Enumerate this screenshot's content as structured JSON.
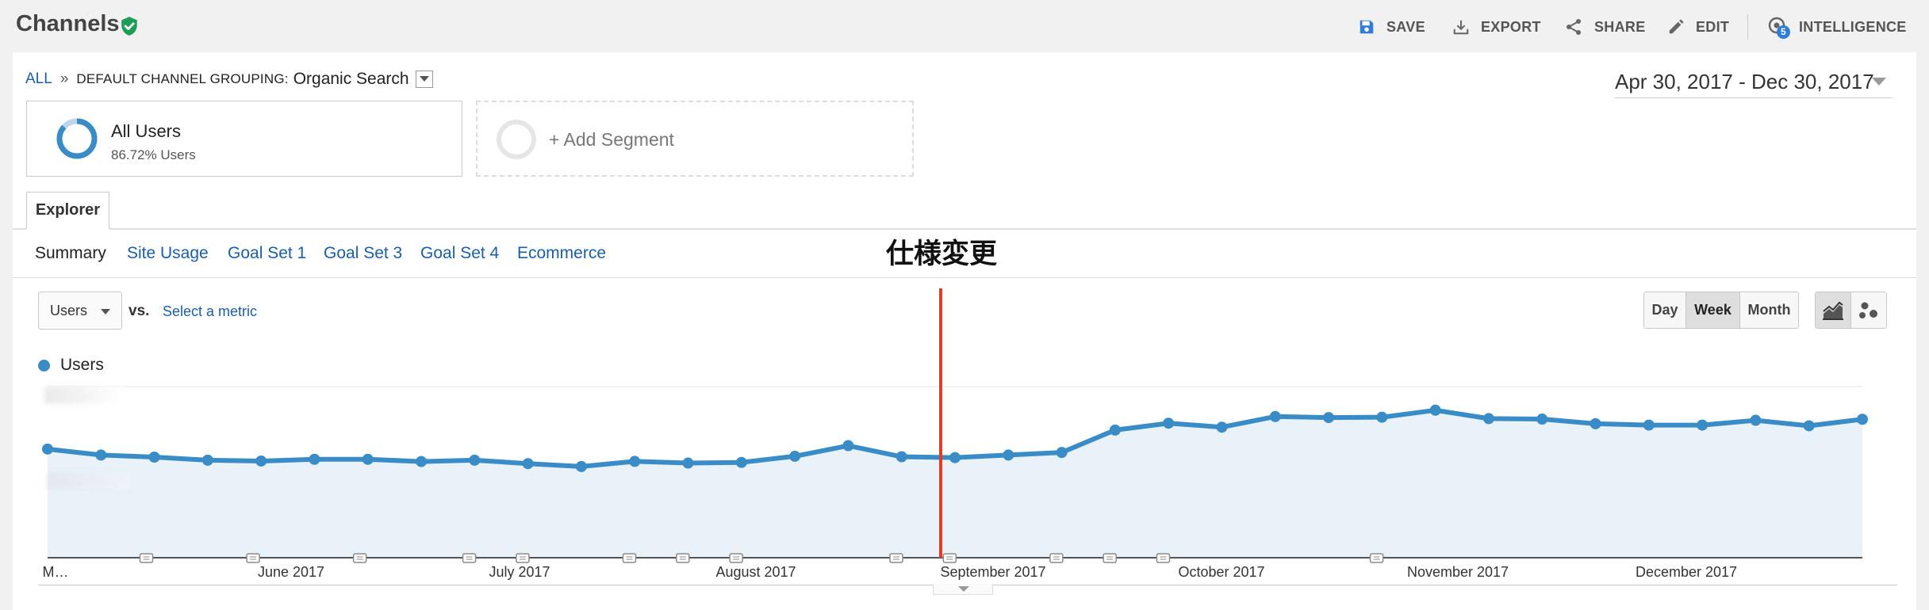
{
  "header": {
    "title": "Channels",
    "actions": [
      {
        "label": "SAVE",
        "icon": "save-icon"
      },
      {
        "label": "EXPORT",
        "icon": "export-icon"
      },
      {
        "label": "SHARE",
        "icon": "share-icon"
      },
      {
        "label": "EDIT",
        "icon": "edit-icon"
      },
      {
        "label": "INTELLIGENCE",
        "icon": "intelligence-icon",
        "badge": "5"
      }
    ]
  },
  "breadcrumb": {
    "all": "ALL",
    "separator": "»",
    "key": "DEFAULT CHANNEL GROUPING:",
    "value": "Organic Search"
  },
  "date_range": "Apr 30, 2017 - Dec 30, 2017",
  "segment": {
    "name": "All Users",
    "subtitle": "86.72% Users",
    "percent": 0.8672,
    "add_label": "+ Add Segment"
  },
  "tabs": {
    "explorer": "Explorer",
    "subtabs": [
      "Summary",
      "Site Usage",
      "Goal Set 1",
      "Goal Set 3",
      "Goal Set 4",
      "Ecommerce"
    ],
    "active_subtab": "Summary"
  },
  "annotation_label": "仕様変更",
  "controls": {
    "metric": "Users",
    "vs": "vs.",
    "select_metric": "Select a metric",
    "periods": [
      "Day",
      "Week",
      "Month"
    ],
    "active_period": "Week"
  },
  "colors": {
    "series": "#3a8cc6",
    "fill": "#e9f1f9",
    "annotation_line": "#e53a23",
    "link": "#1a5ea8"
  },
  "chart_data": {
    "type": "area",
    "series": [
      {
        "name": "Users",
        "values": [
          0.635,
          0.6,
          0.588,
          0.57,
          0.565,
          0.575,
          0.575,
          0.562,
          0.57,
          0.55,
          0.533,
          0.563,
          0.553,
          0.557,
          0.593,
          0.655,
          0.59,
          0.585,
          0.6,
          0.615,
          0.746,
          0.786,
          0.763,
          0.825,
          0.819,
          0.821,
          0.862,
          0.813,
          0.81,
          0.783,
          0.775,
          0.775,
          0.803,
          0.771,
          0.809
        ]
      }
    ],
    "x_tick_labels": [
      "M…",
      "June 2017",
      "July 2017",
      "August 2017",
      "September 2017",
      "October 2017",
      "November 2017",
      "December 2017"
    ],
    "y_axis_labels_visible": false,
    "annotation_after_index": 16,
    "note_markers": 21,
    "grid": true,
    "legend_position": "top-left"
  }
}
